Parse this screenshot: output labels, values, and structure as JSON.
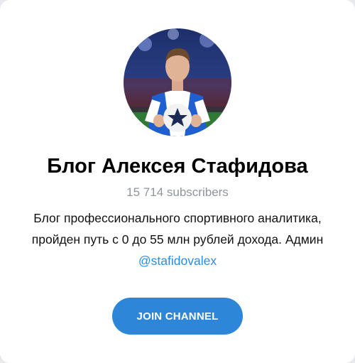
{
  "channel": {
    "title": "Блог Алексея Стафидова",
    "subscribers": "15 714 subscribers",
    "description": "Блог профессионального спортивного аналитика, пройден путь с 0 до 55 млн рублей дохода. Админ ",
    "mention": "@stafidovalex"
  },
  "actions": {
    "join_label": "JOIN CHANNEL"
  },
  "colors": {
    "accent": "#2d86d8",
    "link": "#2d8be3",
    "subtitle": "#8f959b"
  }
}
